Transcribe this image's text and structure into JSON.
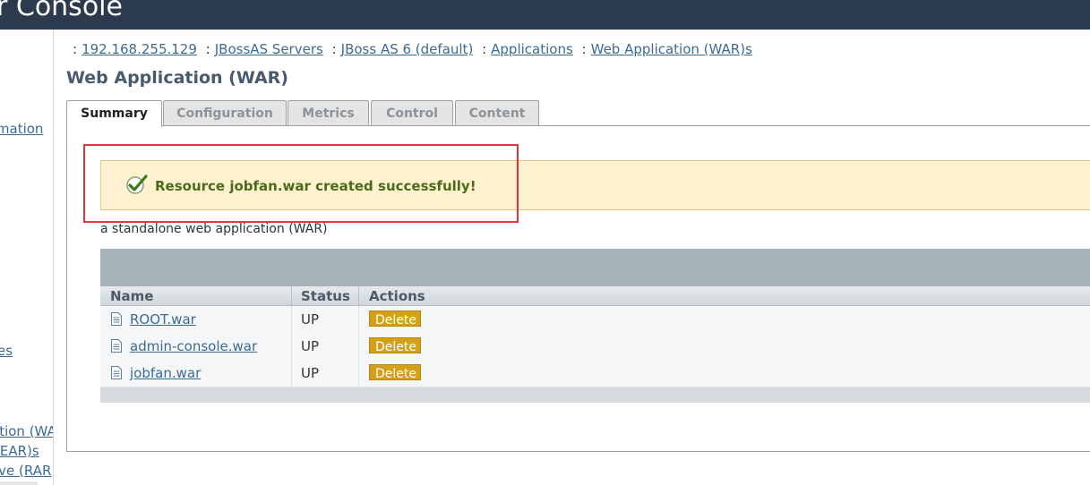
{
  "header": {
    "title": "r Console"
  },
  "sidebar": {
    "items": [
      "rmation",
      "es",
      "ation (WA",
      "(EAR)s",
      "ive (RAR"
    ]
  },
  "breadcrumb": {
    "items": [
      "192.168.255.129",
      "JBossAS Servers",
      "JBoss AS 6 (default)",
      "Applications",
      "Web Application (WAR)s"
    ],
    "separator": ":"
  },
  "page": {
    "title": "Web Application (WAR)"
  },
  "tabs": [
    {
      "label": "Summary",
      "active": true
    },
    {
      "label": "Configuration",
      "active": false
    },
    {
      "label": "Metrics",
      "active": false
    },
    {
      "label": "Control",
      "active": false
    },
    {
      "label": "Content",
      "active": false
    }
  ],
  "message": {
    "text": "Resource jobfan.war created successfully!",
    "icon": "check-icon"
  },
  "description": "a standalone web application (WAR)",
  "table": {
    "columns": [
      "Name",
      "Status",
      "Actions"
    ],
    "rows": [
      {
        "name": "ROOT.war",
        "status": "UP",
        "action": "Delete"
      },
      {
        "name": "admin-console.war",
        "status": "UP",
        "action": "Delete"
      },
      {
        "name": "jobfan.war",
        "status": "UP",
        "action": "Delete"
      }
    ]
  },
  "colors": {
    "header_bg": "#2b3a4c",
    "link": "#3b6b95",
    "message_bg": "#fdf1d0",
    "message_text": "#4b6b1a",
    "highlight": "#e0353b",
    "delete_button": "#d4a017"
  }
}
